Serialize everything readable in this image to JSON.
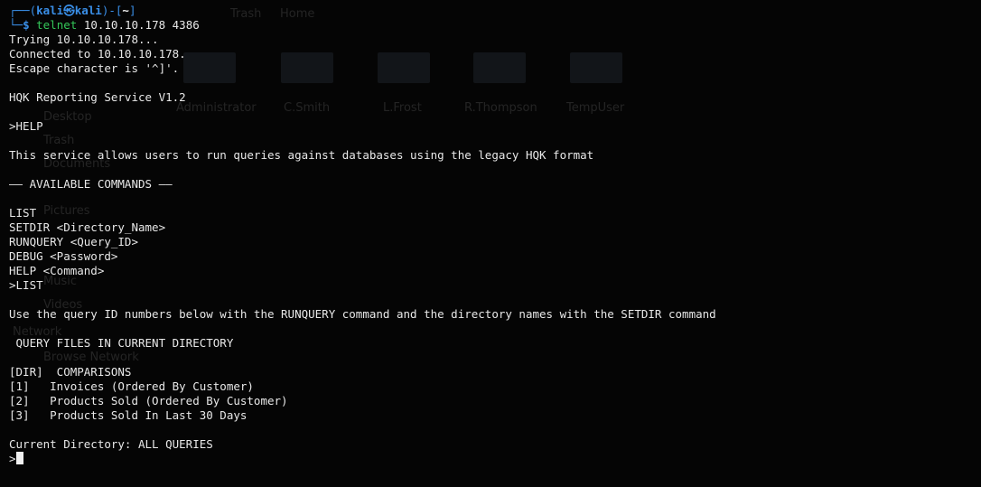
{
  "background": {
    "menu_items": [
      "Trash",
      "Home"
    ],
    "folders": [
      "Administrator",
      "C.Smith",
      "L.Frost",
      "R.Thompson",
      "TempUser"
    ],
    "sidebar_items": [
      "Desktop",
      "Trash",
      "Documents",
      "Pictures",
      "Music",
      "Videos",
      "Network",
      "Browse Network"
    ]
  },
  "prompt": {
    "user": "kali",
    "at_symbol": "㉿",
    "host": "kali",
    "dir": "~",
    "symbol": "$",
    "command": "telnet",
    "args": "10.10.10.178 4386"
  },
  "lines": [
    "Trying 10.10.10.178...",
    "Connected to 10.10.10.178.",
    "Escape character is '^]'.",
    "",
    "HQK Reporting Service V1.2",
    "",
    ">HELP",
    "",
    "This service allows users to run queries against databases using the legacy HQK format",
    "",
    "—— AVAILABLE COMMANDS ——",
    "",
    "LIST",
    "SETDIR <Directory_Name>",
    "RUNQUERY <Query_ID>",
    "DEBUG <Password>",
    "HELP <Command>",
    ">LIST",
    "",
    "Use the query ID numbers below with the RUNQUERY command and the directory names with the SETDIR command",
    "",
    " QUERY FILES IN CURRENT DIRECTORY",
    "",
    "[DIR]  COMPARISONS",
    "[1]   Invoices (Ordered By Customer)",
    "[2]   Products Sold (Ordered By Customer)",
    "[3]   Products Sold In Last 30 Days",
    "",
    "Current Directory: ALL QUERIES"
  ],
  "input_prompt": ">"
}
